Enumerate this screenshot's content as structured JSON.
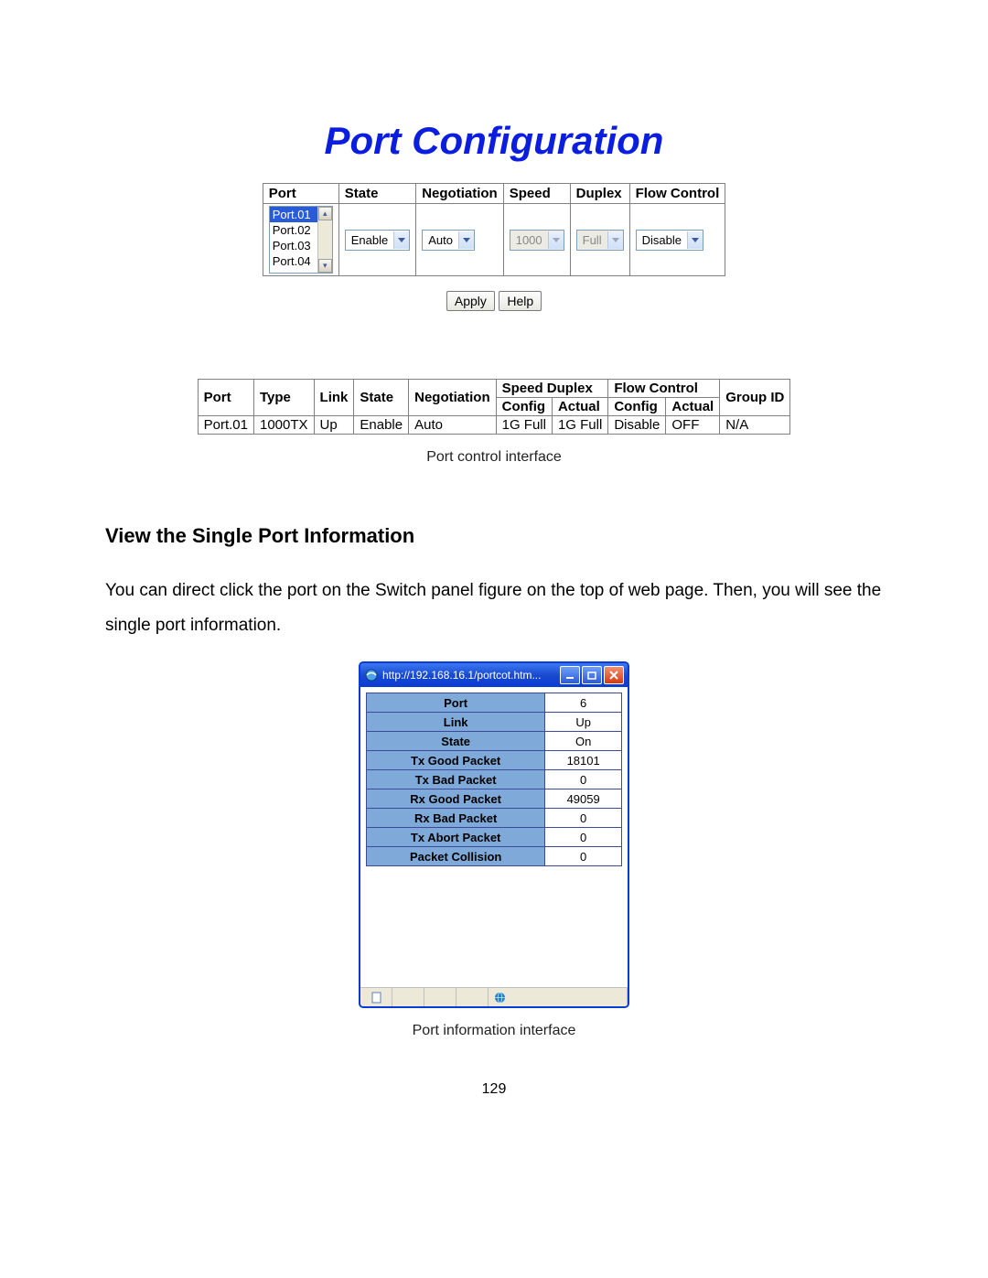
{
  "title": "Port Configuration",
  "cfg_table": {
    "headers": [
      "Port",
      "State",
      "Negotiation",
      "Speed",
      "Duplex",
      "Flow Control"
    ],
    "port_options": [
      "Port.01",
      "Port.02",
      "Port.03",
      "Port.04"
    ],
    "port_selected": "Port.01",
    "state": "Enable",
    "negotiation": "Auto",
    "speed": "1000",
    "duplex": "Full",
    "flow_control": "Disable"
  },
  "buttons": {
    "apply": "Apply",
    "help": "Help"
  },
  "status_table": {
    "h_port": "Port",
    "h_type": "Type",
    "h_link": "Link",
    "h_state": "State",
    "h_neg": "Negotiation",
    "h_speed_duplex": "Speed Duplex",
    "h_flow": "Flow Control",
    "h_group": "Group ID",
    "h_config": "Config",
    "h_actual": "Actual",
    "row": {
      "port": "Port.01",
      "type": "1000TX",
      "link": "Up",
      "state": "Enable",
      "neg": "Auto",
      "sd_config": "1G Full",
      "sd_actual": "1G Full",
      "fc_config": "Disable",
      "fc_actual": "OFF",
      "group": "N/A"
    }
  },
  "caption1": "Port control interface",
  "section_heading": "View the Single Port Information",
  "paragraph": "You can direct click the port on the Switch panel figure on the top of web page. Then, you will see the single port information.",
  "popup": {
    "url": "http://192.168.16.1/portcot.htm...",
    "rows": [
      {
        "k": "Port",
        "v": "6"
      },
      {
        "k": "Link",
        "v": "Up"
      },
      {
        "k": "State",
        "v": "On"
      },
      {
        "k": "Tx Good Packet",
        "v": "18101"
      },
      {
        "k": "Tx Bad Packet",
        "v": "0"
      },
      {
        "k": "Rx Good Packet",
        "v": "49059"
      },
      {
        "k": "Rx Bad Packet",
        "v": "0"
      },
      {
        "k": "Tx Abort Packet",
        "v": "0"
      },
      {
        "k": "Packet Collision",
        "v": "0"
      }
    ]
  },
  "caption2": "Port information interface",
  "page_number": "129"
}
